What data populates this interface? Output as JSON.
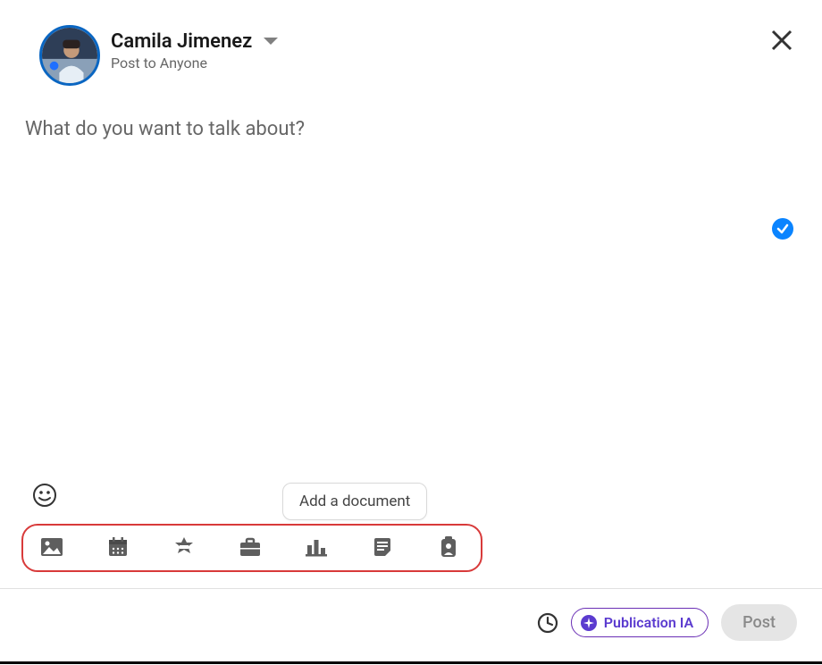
{
  "header": {
    "user_name": "Camila Jimenez",
    "audience_label": "Post to Anyone"
  },
  "compose": {
    "placeholder": "What do you want to talk about?"
  },
  "tooltip": {
    "add_document": "Add a document"
  },
  "toolbar": {
    "icons": {
      "photo": "photo-icon",
      "calendar": "calendar-icon",
      "celebrate": "celebrate-icon",
      "job": "job-icon",
      "poll": "poll-icon",
      "document": "document-icon",
      "hiring": "hiring-icon"
    }
  },
  "footer": {
    "publication_ia_label": "Publication IA",
    "post_label": "Post"
  },
  "icons": {
    "close": "close-icon",
    "dropdown": "chevron-down-icon",
    "emoji": "emoji-icon",
    "clock": "clock-icon",
    "verified": "verified-check-icon"
  },
  "colors": {
    "avatar_ring": "#0a66c2",
    "highlight_border": "#d83a3a",
    "ia_purple": "#5b3bcf",
    "verify_blue": "#0a84ff"
  }
}
